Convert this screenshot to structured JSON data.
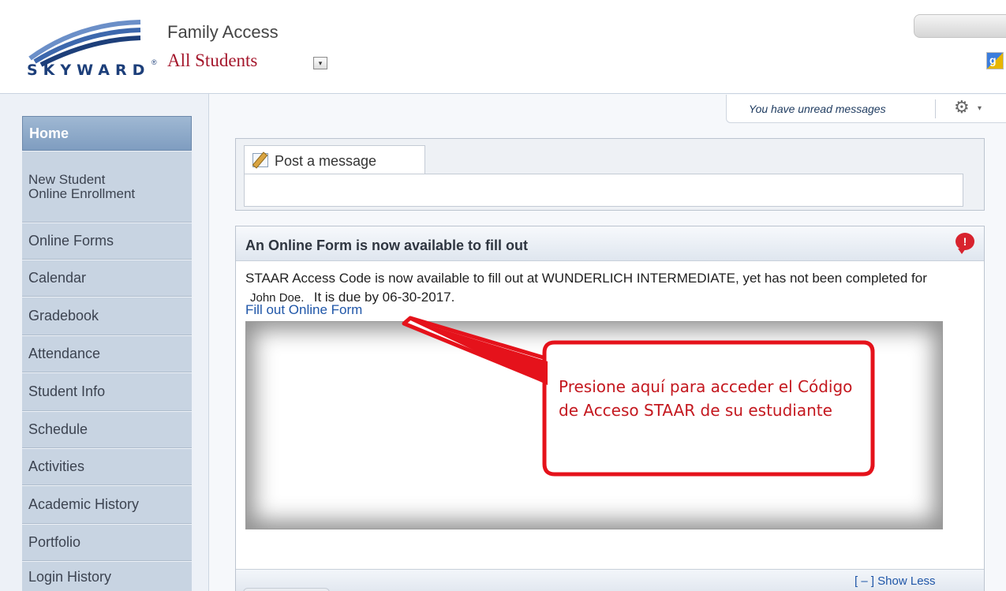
{
  "header": {
    "logo_text": "SKYWARD",
    "logo_reg": "®",
    "app_title": "Family Access",
    "student_selector": "All Students",
    "student_dropdown_glyph": "▾"
  },
  "messages": {
    "unread_text": "You have unread messages",
    "gear_glyph": "⚙",
    "caret_glyph": "▾"
  },
  "sidebar": {
    "items": [
      {
        "label": "Home"
      },
      {
        "label": "New Student Online Enrollment"
      },
      {
        "label": "Online Forms"
      },
      {
        "label": "Calendar"
      },
      {
        "label": "Gradebook"
      },
      {
        "label": "Attendance"
      },
      {
        "label": "Student Info"
      },
      {
        "label": "Schedule"
      },
      {
        "label": "Activities"
      },
      {
        "label": "Academic History"
      },
      {
        "label": "Portfolio"
      },
      {
        "label": "Login History"
      }
    ]
  },
  "post": {
    "tab_label": "Post a message"
  },
  "form": {
    "title": "An Online Form is now available to fill out",
    "alert_glyph": "!",
    "text_before": "STAAR Access Code is now available to fill out at WUNDERLICH INTERMEDIATE, yet has not been completed for",
    "student_name": "John Doe.",
    "text_after": "It is due by 06-30-2017.",
    "link": "Fill out Online Form",
    "show_less": "[ – ] Show Less"
  },
  "annotation": {
    "text": "Presione aquí para acceder el Código de Acceso STAAR de su estudiante",
    "color": "#e5121b"
  }
}
